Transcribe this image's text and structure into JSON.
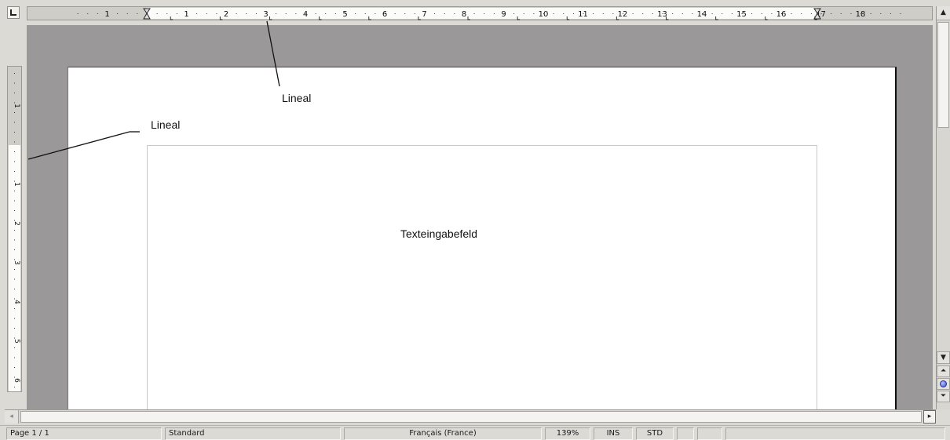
{
  "app": {
    "name": "Text document editor"
  },
  "rulers": {
    "horizontal_numbers": [
      "1",
      "1",
      "2",
      "3",
      "4",
      "5",
      "6",
      "7",
      "8",
      "9",
      "10",
      "11",
      "12",
      "13",
      "14",
      "15",
      "16",
      "17",
      "18"
    ],
    "vertical_numbers": [
      "1",
      "1",
      "2",
      "3",
      "4",
      "5",
      "6"
    ]
  },
  "annotations": {
    "top_ruler_label": "Lineal",
    "left_ruler_label": "Lineal",
    "text_area_label": "Texteingabefeld"
  },
  "statusbar": {
    "page": "Page 1 / 1",
    "page_style": "Standard",
    "language": "Français (France)",
    "zoom": "139%",
    "insert_mode": "INS",
    "selection_mode": "STD",
    "extra1": "",
    "extra2": "",
    "signature": ""
  },
  "icons": {
    "tab_selector": "tab-stop-left-icon",
    "scroll_up": "arrow-up-icon",
    "scroll_down": "arrow-down-icon",
    "scroll_left": "arrow-left-icon",
    "scroll_right": "arrow-right-icon",
    "prev_page": "double-chevron-up-icon",
    "navigation_mode": "navigation-dot-icon",
    "next_page": "double-chevron-down-icon"
  },
  "colors": {
    "workspace_gray": "#9b989a",
    "page_white": "#ffffff",
    "ruler_bg": "#cfcdc8",
    "window_bg": "#dcdad5"
  }
}
